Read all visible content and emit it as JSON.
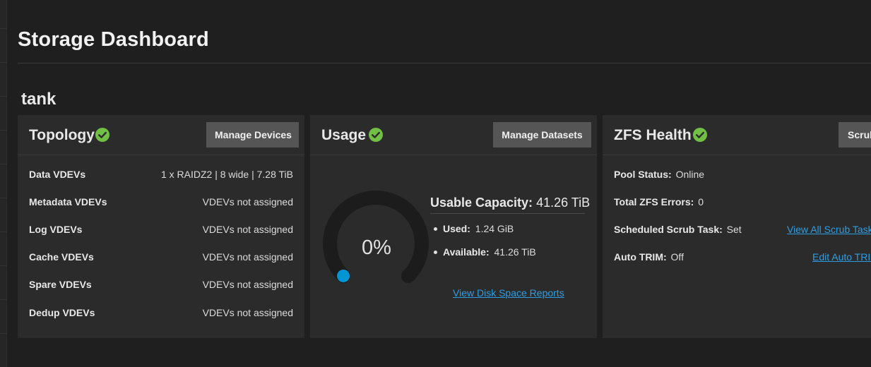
{
  "page": {
    "title": "Storage Dashboard",
    "pool_name": "tank"
  },
  "colors": {
    "background": "#1f1f1f",
    "card": "#2b2b2b",
    "button": "#555555",
    "status_ok": "#71bf44",
    "link": "#2e9ee3",
    "gauge_track": "#1c1c1c",
    "gauge_marker": "#0095d5"
  },
  "topology": {
    "title": "Topology",
    "status_icon": "check-circle-icon",
    "button_label": "Manage Devices",
    "rows": [
      {
        "label": "Data VDEVs",
        "value": "1 x RAIDZ2 | 8 wide | 7.28 TiB"
      },
      {
        "label": "Metadata VDEVs",
        "value": "VDEVs not assigned"
      },
      {
        "label": "Log VDEVs",
        "value": "VDEVs not assigned"
      },
      {
        "label": "Cache VDEVs",
        "value": "VDEVs not assigned"
      },
      {
        "label": "Spare VDEVs",
        "value": "VDEVs not assigned"
      },
      {
        "label": "Dedup VDEVs",
        "value": "VDEVs not assigned"
      }
    ]
  },
  "usage": {
    "title": "Usage",
    "status_icon": "check-circle-icon",
    "button_label": "Manage Datasets",
    "gauge_percent_text": "0%",
    "gauge_fraction": 0,
    "usable_capacity_label": "Usable Capacity:",
    "usable_capacity_value": "41.26 TiB",
    "used_label": "Used:",
    "used_value": "1.24 GiB",
    "available_label": "Available:",
    "available_value": "41.26 TiB",
    "report_link": "View Disk Space Reports"
  },
  "zfs_health": {
    "title": "ZFS Health",
    "status_icon": "check-circle-icon",
    "button_label": "Scrub",
    "pool_status_label": "Pool Status:",
    "pool_status_value": "Online",
    "errors_label": "Total ZFS Errors:",
    "errors_value": "0",
    "scrub_task_label": "Scheduled Scrub Task:",
    "scrub_task_value": "Set",
    "scrub_link": "View All Scrub Tasks",
    "trim_label": "Auto TRIM:",
    "trim_value": "Off",
    "trim_link": "Edit Auto TRIM"
  }
}
